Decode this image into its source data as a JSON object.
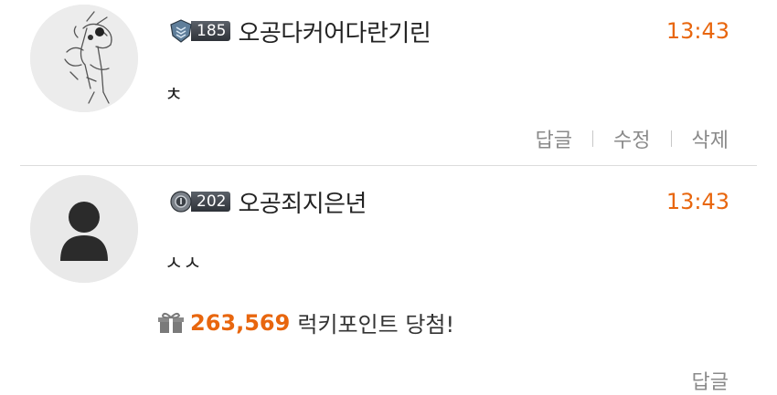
{
  "comments": [
    {
      "level": "185",
      "nickname": "오공다커어다란기린",
      "time": "13:43",
      "content": "ㅊ",
      "actions": {
        "reply": "답글",
        "edit": "수정",
        "delete": "삭제"
      }
    },
    {
      "level": "202",
      "nickname": "오공죄지은년",
      "time": "13:43",
      "content": "ㅅㅅ",
      "lucky_points": "263,569",
      "lucky_text": "럭키포인트 당첨!",
      "actions": {
        "reply": "답글"
      }
    }
  ],
  "colors": {
    "accent": "#e8660e",
    "badge": "#3b4047",
    "muted": "#8a8a8a"
  }
}
